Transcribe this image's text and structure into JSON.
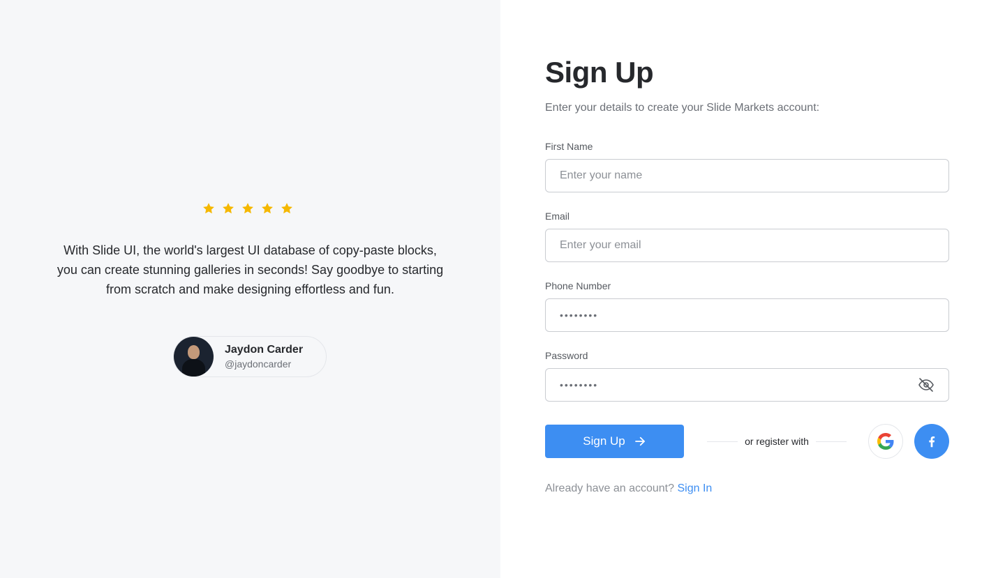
{
  "testimonial": {
    "rating": 5,
    "star_color": "#f5b800",
    "quote": "With Slide UI, the world's largest UI database of copy-paste blocks, you can create stunning galleries in seconds! Say goodbye to starting from scratch and make designing effortless and fun.",
    "author_name": "Jaydon Carder",
    "author_handle": "@jaydoncarder"
  },
  "form": {
    "title": "Sign Up",
    "subtitle": "Enter your details to create your Slide Markets account:",
    "first_name": {
      "label": "First Name",
      "placeholder": "Enter your name",
      "value": ""
    },
    "email": {
      "label": "Email",
      "placeholder": "Enter your email",
      "value": ""
    },
    "phone": {
      "label": "Phone Number",
      "value": "••••••••"
    },
    "password": {
      "label": "Password",
      "value": "••••••••",
      "toggle_icon": "eye-off-icon"
    },
    "submit_label": "Sign Up",
    "submit_icon": "arrow-right-icon",
    "or_text": "or register with",
    "social": [
      {
        "name": "google",
        "icon": "google-icon"
      },
      {
        "name": "facebook",
        "icon": "facebook-icon"
      }
    ],
    "signin_prompt": "Already have an account?",
    "signin_link": "Sign In"
  },
  "colors": {
    "accent": "#3d8ef2",
    "left_bg": "#f6f7f9",
    "text": "#26282c",
    "muted": "#6b6f76"
  }
}
